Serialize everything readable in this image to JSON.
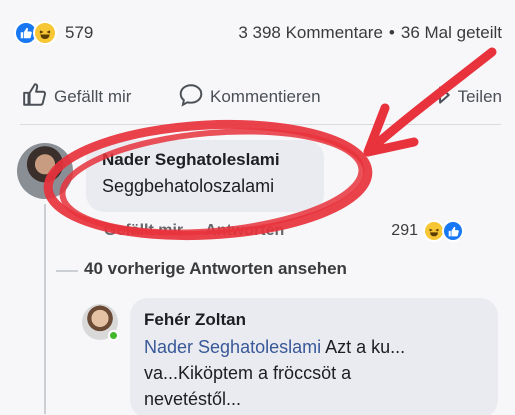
{
  "post_stats": {
    "reaction_count": "579",
    "comments": "3 398 Kommentare",
    "separator": "•",
    "shares": "36 Mal geteilt",
    "reaction_icons": [
      "like-icon",
      "haha-icon"
    ]
  },
  "actions": {
    "like": "Gefällt mir",
    "comment": "Kommentieren",
    "share": "Teilen"
  },
  "comment": {
    "author": "Nader Seghatoleslami",
    "text": "Seggbehatoloszalami",
    "like_label": "Gefällt mir",
    "reply_label": "Antworten",
    "reaction_count": "291"
  },
  "replies": {
    "view_previous": "40 vorherige Antworten ansehen",
    "reply": {
      "author": "Fehér Zoltan",
      "mention": "Nader Seghatoleslami",
      "line1_rest": " Azt a ku...",
      "line2": "va...Kiköptem a fröccsöt a",
      "line3": "nevetéstől..."
    }
  },
  "colors": {
    "facebook_blue": "#1877f2",
    "haha_yellow": "#f7c634",
    "annotation_red": "#e8323c",
    "mention_blue": "#385898"
  }
}
